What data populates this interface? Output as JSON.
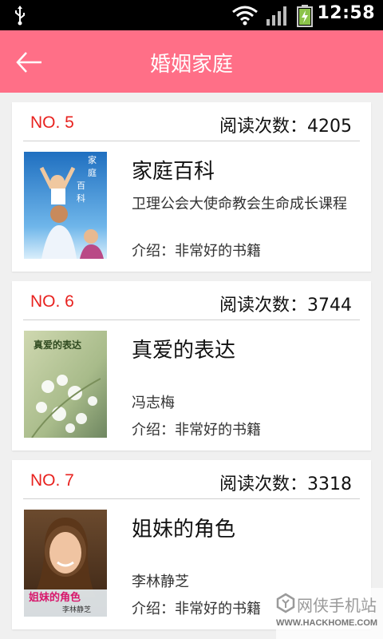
{
  "status_bar": {
    "time": "12:58",
    "icons": [
      "usb-icon",
      "wifi-icon",
      "signal-icon",
      "battery-charging-icon"
    ]
  },
  "header": {
    "title": "婚姻家庭",
    "back_icon": "back-arrow-icon",
    "background": "#ff6f87"
  },
  "books": [
    {
      "rank": "NO. 5",
      "reads": "阅读次数：4205",
      "name": "家庭百科",
      "author": "卫理公会大使命教会生命成长课程",
      "intro": "介绍：非常好的书籍",
      "cover_text": "家庭百科"
    },
    {
      "rank": "NO. 6",
      "reads": "阅读次数：3744",
      "name": "真爱的表达",
      "author": "冯志梅",
      "intro": "介绍：非常好的书籍",
      "cover_text": "真爱的表达"
    },
    {
      "rank": "NO. 7",
      "reads": "阅读次数：3318",
      "name": "姐妹的角色",
      "author": "李林静芝",
      "intro": "介绍：非常好的书籍",
      "cover_text": "姐妹的角色"
    }
  ],
  "watermark": {
    "main": "网侠手机站",
    "sub": "WWW.HACKHOME.COM"
  },
  "colors": {
    "accent": "#ff6f87",
    "rank": "#e8221f"
  }
}
